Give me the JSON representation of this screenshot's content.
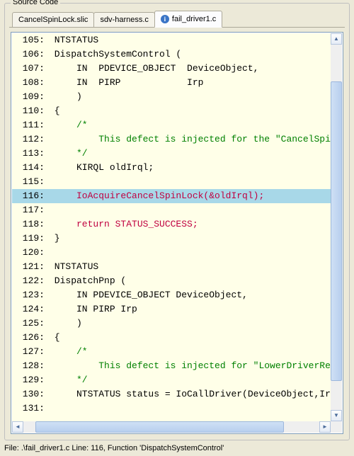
{
  "panel": {
    "title": "Source Code"
  },
  "tabs": [
    {
      "label": "CancelSpinLock.slic",
      "active": false,
      "icon": false
    },
    {
      "label": "sdv-harness.c",
      "active": false,
      "icon": false
    },
    {
      "label": "fail_driver1.c",
      "active": true,
      "icon": true
    }
  ],
  "code": {
    "first_line": 105,
    "highlighted_line": 116,
    "lines": [
      {
        "n": 105,
        "text": "NTSTATUS",
        "cls": ""
      },
      {
        "n": 106,
        "text": "DispatchSystemControl (",
        "cls": ""
      },
      {
        "n": 107,
        "text": "    IN  PDEVICE_OBJECT  DeviceObject,",
        "cls": ""
      },
      {
        "n": 108,
        "text": "    IN  PIRP            Irp",
        "cls": ""
      },
      {
        "n": 109,
        "text": "    )",
        "cls": ""
      },
      {
        "n": 110,
        "text": "{",
        "cls": ""
      },
      {
        "n": 111,
        "text": "    /*",
        "cls": "comment"
      },
      {
        "n": 112,
        "text": "        This defect is injected for the \"CancelSpinL",
        "cls": "comment"
      },
      {
        "n": 113,
        "text": "    */",
        "cls": "comment"
      },
      {
        "n": 114,
        "text": "    KIRQL oldIrql;",
        "cls": ""
      },
      {
        "n": 115,
        "text": "",
        "cls": ""
      },
      {
        "n": 116,
        "text": "    IoAcquireCancelSpinLock(&oldIrql);",
        "cls": "error"
      },
      {
        "n": 117,
        "text": "",
        "cls": ""
      },
      {
        "n": 118,
        "text": "    return STATUS_SUCCESS;",
        "cls": "error"
      },
      {
        "n": 119,
        "text": "}",
        "cls": ""
      },
      {
        "n": 120,
        "text": "",
        "cls": ""
      },
      {
        "n": 121,
        "text": "NTSTATUS",
        "cls": ""
      },
      {
        "n": 122,
        "text": "DispatchPnp (",
        "cls": ""
      },
      {
        "n": 123,
        "text": "    IN PDEVICE_OBJECT DeviceObject,",
        "cls": ""
      },
      {
        "n": 124,
        "text": "    IN PIRP Irp",
        "cls": ""
      },
      {
        "n": 125,
        "text": "    )",
        "cls": ""
      },
      {
        "n": 126,
        "text": "{",
        "cls": ""
      },
      {
        "n": 127,
        "text": "    /*",
        "cls": "comment"
      },
      {
        "n": 128,
        "text": "        This defect is injected for \"LowerDriverRetu",
        "cls": "comment"
      },
      {
        "n": 129,
        "text": "    */",
        "cls": "comment"
      },
      {
        "n": 130,
        "text": "    NTSTATUS status = IoCallDriver(DeviceObject,Irp",
        "cls": ""
      },
      {
        "n": 131,
        "text": "",
        "cls": ""
      }
    ]
  },
  "scroll": {
    "v_thumb_top_pct": 10,
    "v_thumb_height_pct": 82,
    "h_thumb_left_pct": 4,
    "h_thumb_width_pct": 84
  },
  "status": {
    "text": "File: .\\fail_driver1.c   Line: 116,   Function 'DispatchSystemControl'"
  }
}
